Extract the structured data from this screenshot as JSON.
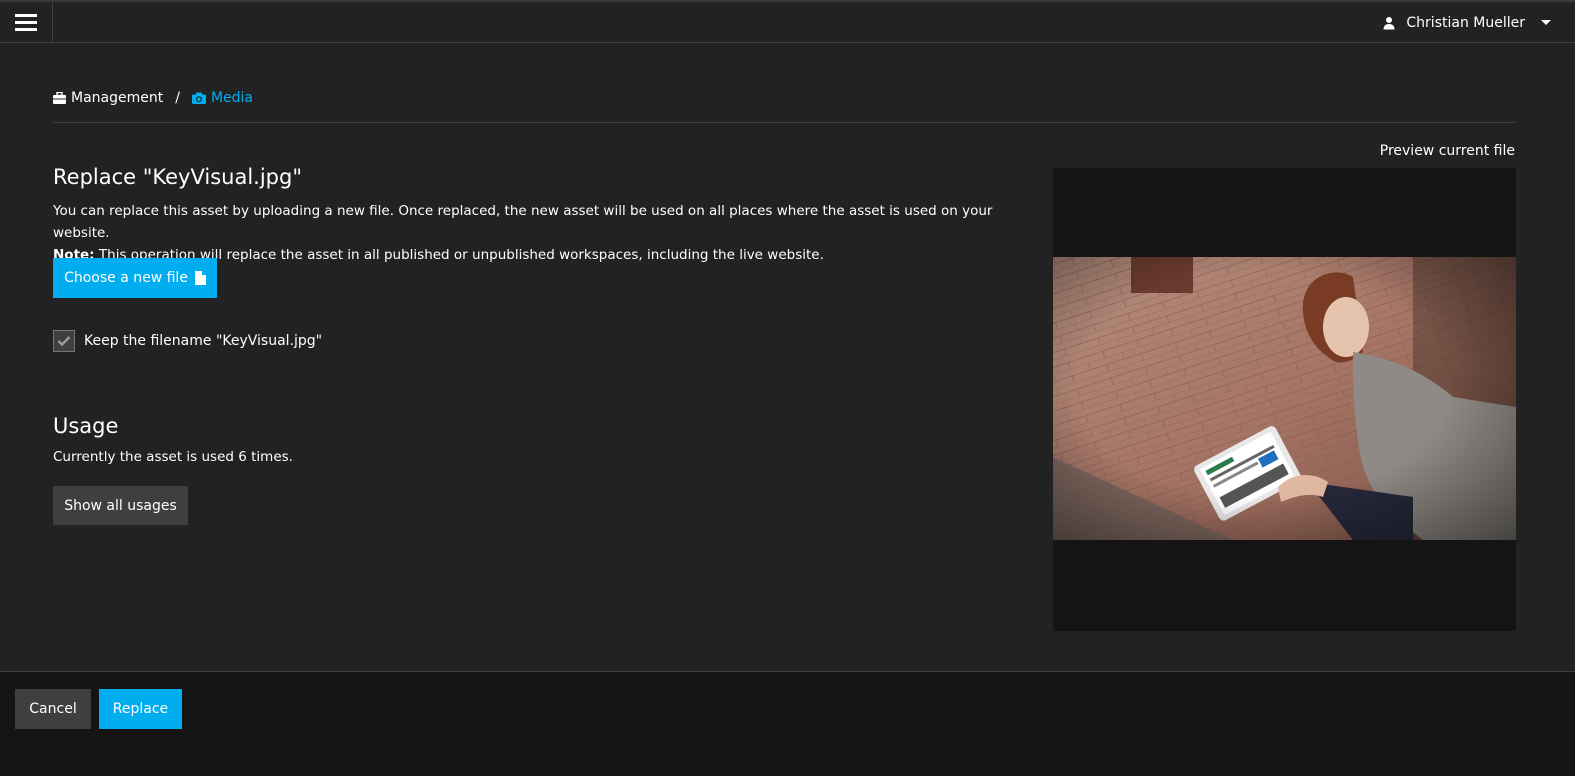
{
  "topbar": {
    "user_name": "Christian Mueller"
  },
  "breadcrumb": {
    "items": [
      {
        "label": "Management",
        "icon": "briefcase-icon"
      },
      {
        "label": "Media",
        "icon": "camera-icon"
      }
    ],
    "separator": "/"
  },
  "replace": {
    "title": "Replace \"KeyVisual.jpg\"",
    "description": "You can replace this asset by uploading a new file. Once replaced, the new asset will be used on all places where the asset is used on your website.",
    "note_label": "Note:",
    "note_text": " This operation will replace the asset in all published or unpublished workspaces, including the live website.",
    "choose_button": "Choose a new file",
    "keep_filename_label": "Keep the filename \"KeyVisual.jpg\"",
    "keep_filename_checked": true
  },
  "usage": {
    "title": "Usage",
    "text": "Currently the asset is used 6 times.",
    "show_button": "Show all usages"
  },
  "preview": {
    "label": "Preview current file"
  },
  "footer": {
    "cancel_label": "Cancel",
    "replace_label": "Replace"
  },
  "colors": {
    "background": "#222222",
    "accent": "#00adee",
    "secondary_button": "#3f3f3f",
    "footer": "#141414"
  }
}
